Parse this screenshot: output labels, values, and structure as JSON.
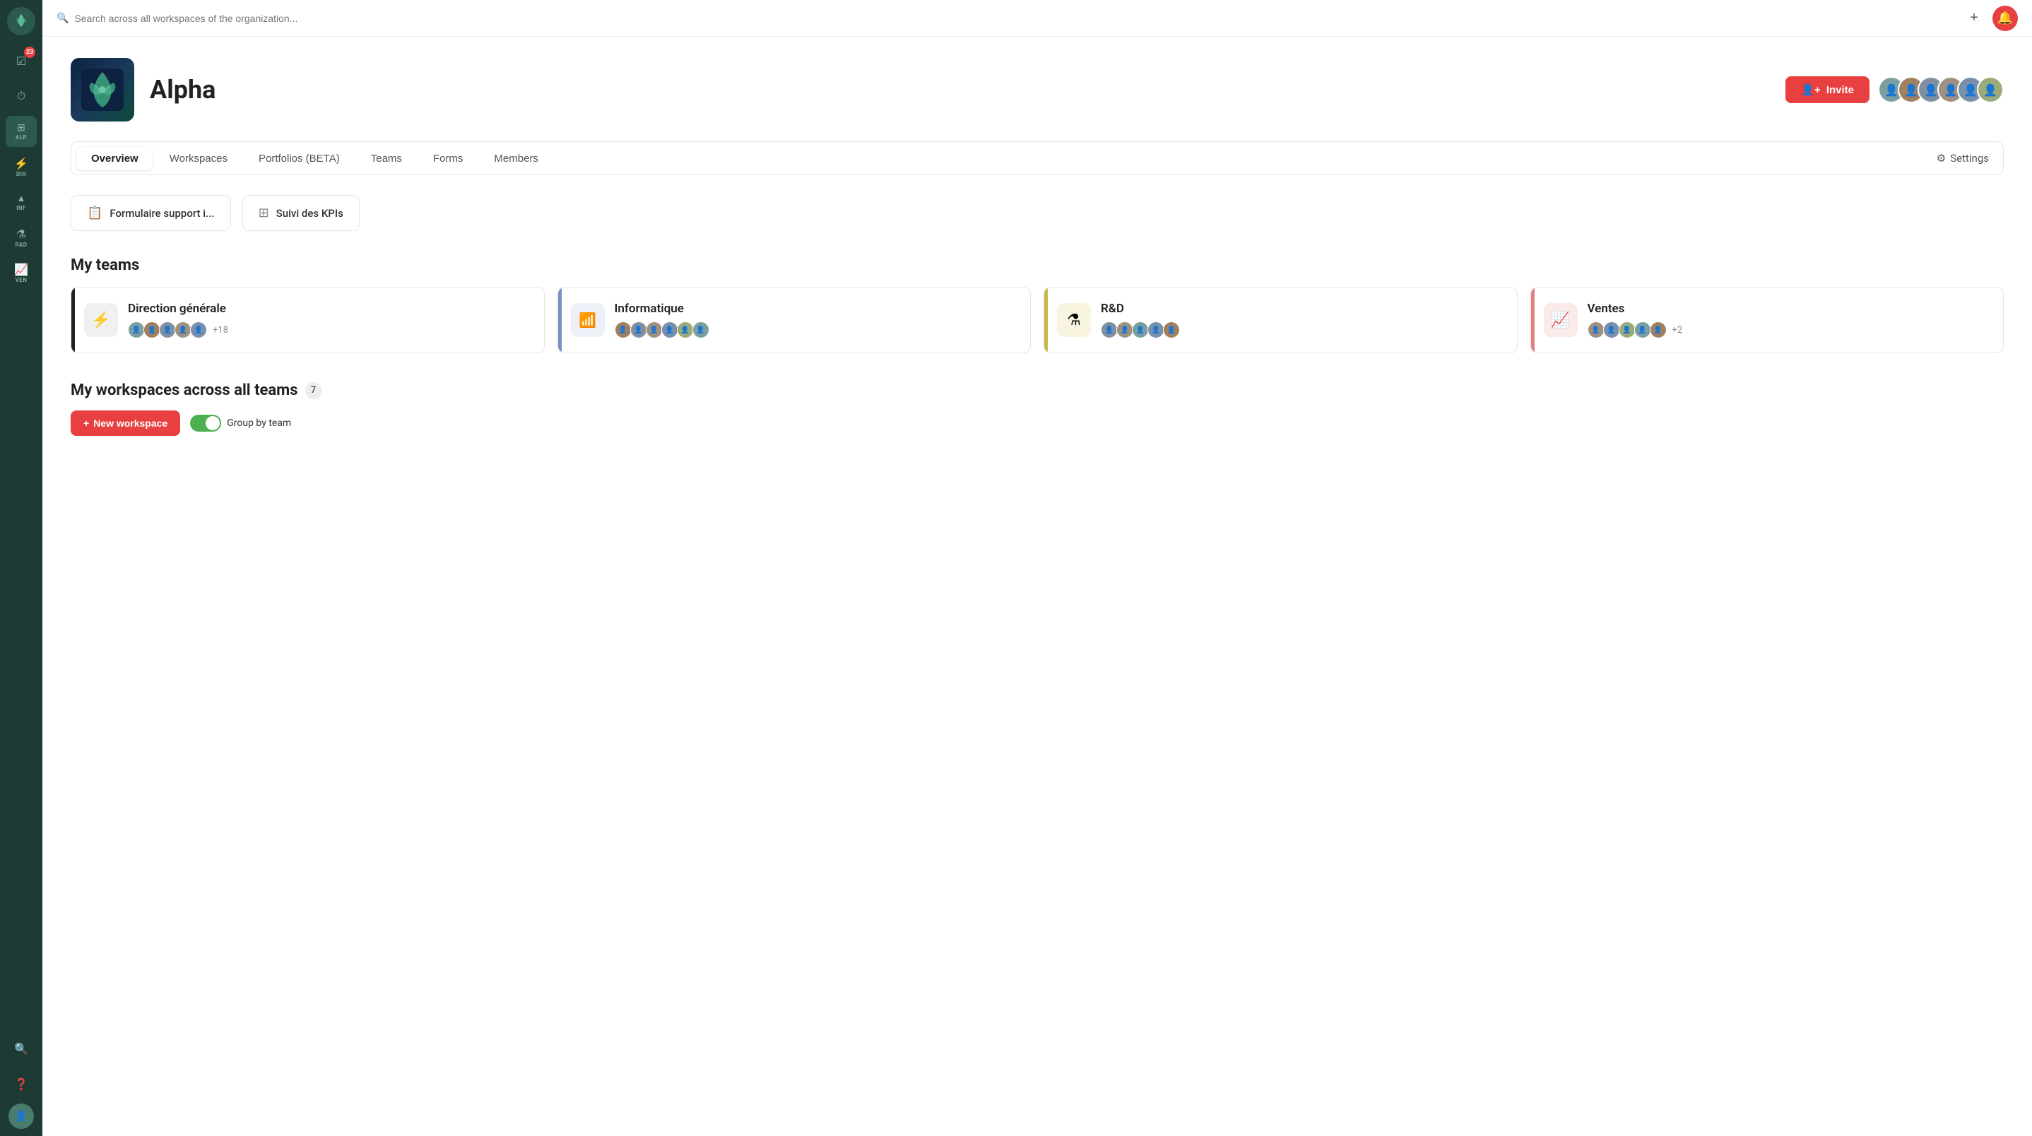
{
  "topbar": {
    "search_placeholder": "Search across all workspaces of the organization..."
  },
  "sidebar": {
    "badge_count": "23",
    "items": [
      {
        "id": "home",
        "icon": "🏠",
        "label": ""
      },
      {
        "id": "tasks",
        "icon": "✅",
        "label": ""
      },
      {
        "id": "clock",
        "icon": "🕐",
        "label": ""
      },
      {
        "id": "grid",
        "icon": "▦",
        "label": "ALP"
      },
      {
        "id": "dir",
        "icon": "⚡",
        "label": "DIR"
      },
      {
        "id": "inf",
        "icon": "📶",
        "label": "INF"
      },
      {
        "id": "rnd",
        "icon": "🔬",
        "label": "R&D"
      },
      {
        "id": "ven",
        "icon": "📈",
        "label": "VEN"
      }
    ]
  },
  "org": {
    "name": "Alpha",
    "invite_label": "Invite"
  },
  "tabs": [
    {
      "id": "overview",
      "label": "Overview",
      "active": true
    },
    {
      "id": "workspaces",
      "label": "Workspaces",
      "active": false
    },
    {
      "id": "portfolios",
      "label": "Portfolios (BETA)",
      "active": false
    },
    {
      "id": "teams",
      "label": "Teams",
      "active": false
    },
    {
      "id": "forms",
      "label": "Forms",
      "active": false
    },
    {
      "id": "members",
      "label": "Members",
      "active": false
    }
  ],
  "settings_label": "Settings",
  "quick_links": [
    {
      "id": "form",
      "icon": "📋",
      "label": "Formulaire support i..."
    },
    {
      "id": "kpi",
      "icon": "▦",
      "label": "Suivi des KPIs"
    }
  ],
  "my_teams": {
    "title": "My teams",
    "teams": [
      {
        "id": "direction",
        "name": "Direction générale",
        "icon": "⚡",
        "accent_color": "#222",
        "icon_bg": "#f0f0f0",
        "members_extra": "+18"
      },
      {
        "id": "informatique",
        "name": "Informatique",
        "icon": "📶",
        "accent_color": "#7b8fc0",
        "icon_bg": "#eef0f8",
        "members_extra": ""
      },
      {
        "id": "rnd",
        "name": "R&D",
        "icon": "🔬",
        "accent_color": "#c8b84a",
        "icon_bg": "#f8f4e0",
        "members_extra": ""
      },
      {
        "id": "ventes",
        "name": "Ventes",
        "icon": "📈",
        "accent_color": "#e08080",
        "icon_bg": "#faeaea",
        "members_extra": "+2"
      }
    ]
  },
  "my_workspaces": {
    "title": "My workspaces across all teams",
    "count": "7",
    "new_workspace_label": "New workspace",
    "group_by_team_label": "Group by team"
  }
}
